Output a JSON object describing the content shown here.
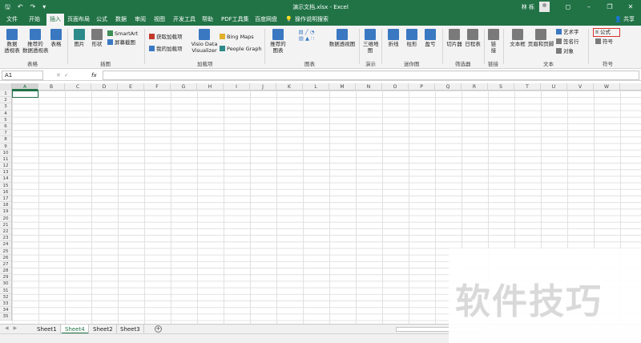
{
  "window": {
    "title": "演示文档.xlsx  -  Excel",
    "user": "林 栎",
    "share_label": "共享"
  },
  "ribbon_tabs": [
    "文件",
    "开始",
    "插入",
    "页面布局",
    "公式",
    "数据",
    "审阅",
    "视图",
    "开发工具",
    "帮助",
    "PDF工具集",
    "百度网盘",
    "操作说明搜索"
  ],
  "active_tab": "插入",
  "ribbon": {
    "tables": {
      "label": "表格",
      "pivot": "数据\n透视表",
      "rec_pivot": "推荐的\n数据透视表",
      "table": "表格"
    },
    "illustrations": {
      "label": "插图",
      "pictures": "图片",
      "shapes": "形状",
      "smartart": "SmartArt",
      "screenshot": "屏幕截图"
    },
    "addins": {
      "label": "加载项",
      "get": "获取加载项",
      "my": "我的加载项",
      "visio": "Visio Data\nVisualizer",
      "bing": "Bing Maps",
      "people": "People Graph"
    },
    "charts": {
      "label": "图表",
      "recommended": "推荐的\n图表",
      "pivot_chart": "数据透视图"
    },
    "tours": {
      "label": "演示",
      "map3d": "三维地\n图"
    },
    "sparklines": {
      "label": "迷你图",
      "line": "折线",
      "column": "柱形",
      "winloss": "盈亏"
    },
    "filters": {
      "label": "筛选器",
      "slicer": "切片器",
      "timeline": "日程表"
    },
    "links": {
      "label": "链接",
      "link": "链\n接"
    },
    "text": {
      "label": "文本",
      "textbox": "文本框",
      "header": "页眉和页脚",
      "wordart": "艺术字",
      "sigline": "签名行",
      "object": "对象"
    },
    "symbols": {
      "label": "符号",
      "equation": "公式",
      "symbol": "符号"
    }
  },
  "formula_bar": {
    "name_box": "A1",
    "fx": "fx",
    "value": ""
  },
  "columns": [
    "A",
    "B",
    "C",
    "D",
    "E",
    "F",
    "G",
    "H",
    "I",
    "J",
    "K",
    "L",
    "M",
    "N",
    "O",
    "P",
    "Q",
    "R",
    "S",
    "T",
    "U",
    "V",
    "W"
  ],
  "rows": [
    "1",
    "2",
    "3",
    "4",
    "5",
    "6",
    "7",
    "8",
    "9",
    "10",
    "11",
    "12",
    "13",
    "14",
    "15",
    "16",
    "17",
    "18",
    "19",
    "20",
    "21",
    "22",
    "23",
    "24",
    "25",
    "26",
    "27",
    "28",
    "29",
    "30",
    "31",
    "32",
    "33",
    "34",
    "35"
  ],
  "sheets": [
    "Sheet1",
    "Sheet4",
    "Sheet2",
    "Sheet3"
  ],
  "active_sheet": "Sheet4",
  "watermark": "软件技巧",
  "colors": {
    "accent": "#217346",
    "highlight": "#d9342b"
  }
}
